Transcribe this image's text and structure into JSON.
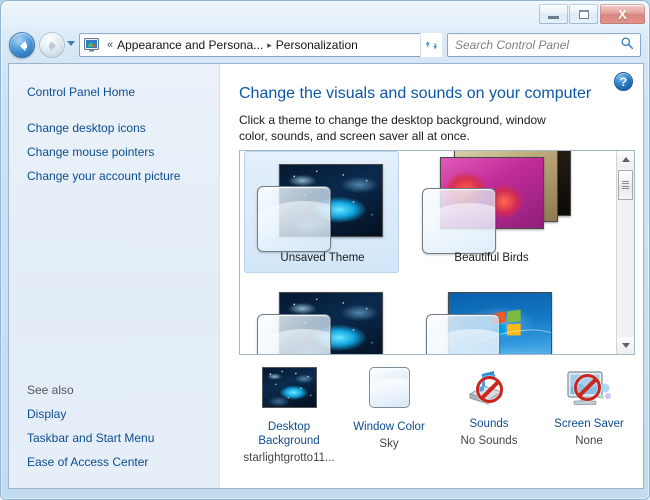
{
  "window": {
    "minimize_label": "Minimize",
    "maximize_label": "Maximize",
    "close_label": "X"
  },
  "nav": {
    "back_label": "Back",
    "forward_label": "Forward",
    "recent_label": "Recent pages",
    "chevrons": "«",
    "separator": "▸",
    "breadcrumbs": [
      {
        "label": "Appearance and Persona..."
      },
      {
        "label": "Personalization"
      }
    ],
    "address_icon": "control-panel-display-icon",
    "refresh_label": "Refresh",
    "dropdown_label": "Previous locations"
  },
  "search": {
    "placeholder": "Search Control Panel",
    "value": "",
    "icon": "search-icon"
  },
  "sidebar": {
    "home_label": "Control Panel Home",
    "links": [
      {
        "label": "Change desktop icons"
      },
      {
        "label": "Change mouse pointers"
      },
      {
        "label": "Change your account picture"
      }
    ],
    "see_also_label": "See also",
    "see_also_links": [
      {
        "label": "Display"
      },
      {
        "label": "Taskbar and Start Menu"
      },
      {
        "label": "Ease of Access Center"
      }
    ]
  },
  "main": {
    "help_label": "?",
    "title": "Change the visuals and sounds on your computer",
    "description": "Click a theme to change the desktop background, window color, sounds, and screen saver all at once."
  },
  "gallery": {
    "themes": [
      {
        "label": "Unsaved Theme",
        "selected": true,
        "art": "grotto"
      },
      {
        "label": "Beautiful Birds",
        "selected": false,
        "art": "birds"
      },
      {
        "label": "",
        "selected": false,
        "art": "grotto"
      },
      {
        "label": "",
        "selected": false,
        "art": "win7"
      }
    ],
    "scroll_up_label": "Scroll up",
    "scroll_down_label": "Scroll down"
  },
  "settings": [
    {
      "name": "desktop-background",
      "link": "Desktop Background",
      "sub": "starlightgrotto11...",
      "icon": "wallpaper-thumbnail-icon"
    },
    {
      "name": "window-color",
      "link": "Window Color",
      "sub": "Sky",
      "icon": "window-color-swatch-icon"
    },
    {
      "name": "sounds",
      "link": "Sounds",
      "sub": "No Sounds",
      "icon": "speaker-muted-icon"
    },
    {
      "name": "screen-saver",
      "link": "Screen Saver",
      "sub": "None",
      "icon": "monitor-disabled-icon"
    }
  ],
  "colors": {
    "accent_link": "#0d4c91",
    "title_blue": "#0c58a6",
    "selection": "#d2e6f8",
    "close_red": "#bf3d33"
  }
}
